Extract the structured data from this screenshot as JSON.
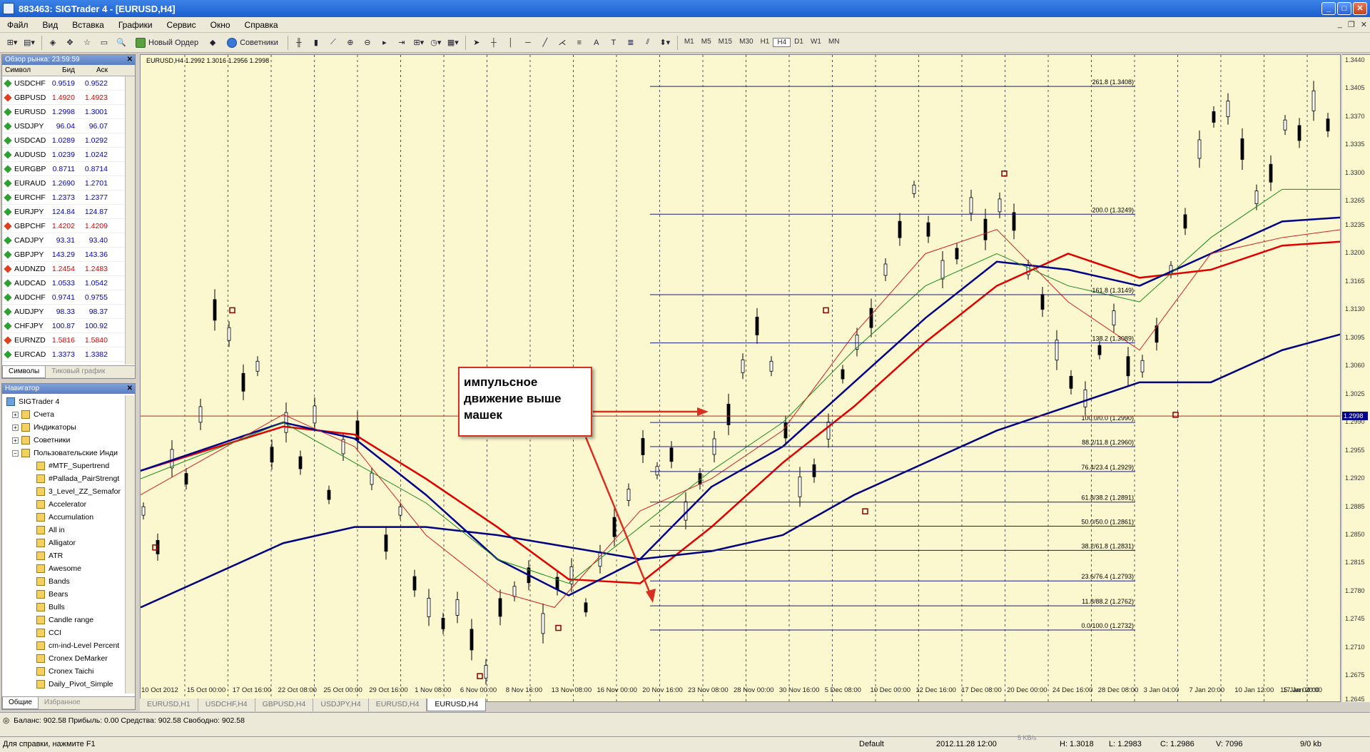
{
  "window": {
    "title": "883463: SIGTrader 4 - [EURUSD,H4]"
  },
  "menu": [
    "Файл",
    "Вид",
    "Вставка",
    "Графики",
    "Сервис",
    "Окно",
    "Справка"
  ],
  "toolbar": {
    "new_order": "Новый Ордер",
    "experts": "Советники",
    "timeframes": [
      "M1",
      "M5",
      "M15",
      "M30",
      "H1",
      "H4",
      "D1",
      "W1",
      "MN"
    ],
    "active_tf": "H4",
    "text_tool": "A",
    "label_tool": "T"
  },
  "market_watch": {
    "title": "Обзор рынка: 23:59:59",
    "headers": [
      "Символ",
      "Бид",
      "Аск"
    ],
    "rows": [
      {
        "s": "USDCHF",
        "b": "0.9519",
        "a": "0.9522",
        "d": "up"
      },
      {
        "s": "GBPUSD",
        "b": "1.4920",
        "a": "1.4923",
        "d": "dn"
      },
      {
        "s": "EURUSD",
        "b": "1.2998",
        "a": "1.3001",
        "d": "up"
      },
      {
        "s": "USDJPY",
        "b": "96.04",
        "a": "96.07",
        "d": "up"
      },
      {
        "s": "USDCAD",
        "b": "1.0289",
        "a": "1.0292",
        "d": "up"
      },
      {
        "s": "AUDUSD",
        "b": "1.0239",
        "a": "1.0242",
        "d": "up"
      },
      {
        "s": "EURGBP",
        "b": "0.8711",
        "a": "0.8714",
        "d": "up"
      },
      {
        "s": "EURAUD",
        "b": "1.2690",
        "a": "1.2701",
        "d": "up"
      },
      {
        "s": "EURCHF",
        "b": "1.2373",
        "a": "1.2377",
        "d": "up"
      },
      {
        "s": "EURJPY",
        "b": "124.84",
        "a": "124.87",
        "d": "up"
      },
      {
        "s": "GBPCHF",
        "b": "1.4202",
        "a": "1.4209",
        "d": "dn"
      },
      {
        "s": "CADJPY",
        "b": "93.31",
        "a": "93.40",
        "d": "up"
      },
      {
        "s": "GBPJPY",
        "b": "143.29",
        "a": "143.36",
        "d": "up"
      },
      {
        "s": "AUDNZD",
        "b": "1.2454",
        "a": "1.2483",
        "d": "dn"
      },
      {
        "s": "AUDCAD",
        "b": "1.0533",
        "a": "1.0542",
        "d": "up"
      },
      {
        "s": "AUDCHF",
        "b": "0.9741",
        "a": "0.9755",
        "d": "up"
      },
      {
        "s": "AUDJPY",
        "b": "98.33",
        "a": "98.37",
        "d": "up"
      },
      {
        "s": "CHFJPY",
        "b": "100.87",
        "a": "100.92",
        "d": "up"
      },
      {
        "s": "EURNZD",
        "b": "1.5816",
        "a": "1.5840",
        "d": "dn"
      },
      {
        "s": "EURCAD",
        "b": "1.3373",
        "a": "1.3382",
        "d": "up"
      }
    ],
    "tabs": [
      "Символы",
      "Тиковый график"
    ]
  },
  "navigator": {
    "title": "Навигатор",
    "root": "SIGTrader 4",
    "groups": [
      "Счета",
      "Индикаторы",
      "Советники",
      "Пользовательские Инди"
    ],
    "items": [
      "#MTF_Supertrend",
      "#Pallada_PairStrengt",
      "3_Level_ZZ_Semafor",
      "Accelerator",
      "Accumulation",
      "All in",
      "Alligator",
      "ATR",
      "Awesome",
      "Bands",
      "Bears",
      "Bulls",
      "Candle range",
      "CCI",
      "cm-ind-Level Percent",
      "Cronex DeMarker",
      "Cronex Taichi",
      "Daily_Pivot_Simple"
    ],
    "tabs": [
      "Общие",
      "Избранное"
    ]
  },
  "chart": {
    "symbol_line": "EURUSD,H4  1.2992 1.3016 1.2956 1.2998",
    "current_price": "1.2998",
    "yticks": [
      "1.3440",
      "1.3405",
      "1.3370",
      "1.3335",
      "1.3300",
      "1.3265",
      "1.3235",
      "1.3200",
      "1.3165",
      "1.3130",
      "1.3095",
      "1.3060",
      "1.3025",
      "1.2990",
      "1.2955",
      "1.2920",
      "1.2885",
      "1.2850",
      "1.2815",
      "1.2780",
      "1.2745",
      "1.2710",
      "1.2675",
      "1.2645"
    ],
    "xticks": [
      "10 Oct 2012",
      "15 Oct 00:00",
      "17 Oct 16:00",
      "22 Oct 08:00",
      "25 Oct 00:00",
      "29 Oct 16:00",
      "1 Nov 08:00",
      "6 Nov 00:00",
      "8 Nov 16:00",
      "13 Nov 08:00",
      "16 Nov 00:00",
      "20 Nov 16:00",
      "23 Nov 08:00",
      "28 Nov 00:00",
      "30 Nov 16:00",
      "5 Dec 08:00",
      "10 Dec 00:00",
      "12 Dec 16:00",
      "17 Dec 08:00",
      "20 Dec 00:00",
      "24 Dec 16:00",
      "28 Dec 08:00",
      "3 Jan 04:00",
      "7 Jan 20:00",
      "10 Jan 12:00",
      "15 Jan 04:00",
      "17 Jan 20:00"
    ],
    "fibo": [
      {
        "label": "261.8 (1.3408)",
        "price": 1.3408
      },
      {
        "label": "200.0 (1.3249)",
        "price": 1.3249
      },
      {
        "label": "161.8 (1.3149)",
        "price": 1.3149
      },
      {
        "label": "138.2 (1.3089)",
        "price": 1.3089
      },
      {
        "label": "100.0/0.0 (1.2990)",
        "price": 1.299
      },
      {
        "label": "88.2/11.8 (1.2960)",
        "price": 1.296
      },
      {
        "label": "76.4/23.4 (1.2929)",
        "price": 1.2929
      },
      {
        "label": "61.8/38.2 (1.2891)",
        "price": 1.2891
      },
      {
        "label": "50.0/50.0 (1.2861)",
        "price": 1.2861
      },
      {
        "label": "38.2/61.8 (1.2831)",
        "price": 1.2831
      },
      {
        "label": "23.6/76.4 (1.2793)",
        "price": 1.2793
      },
      {
        "label": "11.8/88.2 (1.2762)",
        "price": 1.2762
      },
      {
        "label": "0.0/100.0 (1.2732)",
        "price": 1.2732
      }
    ],
    "annotation": "импульсное движение выше машек",
    "tabs": [
      "EURUSD,H1",
      "USDCHF,H4",
      "GBPUSD,H4",
      "USDJPY,H4",
      "EURUSD,H4",
      "EURUSD,H4"
    ]
  },
  "terminal": {
    "balance_line": "Баланс: 902.58  Прибыль: 0.00  Средства: 902.58  Свободно: 902.58"
  },
  "status": {
    "help": "Для справки, нажмите F1",
    "profile": "Default",
    "time": "2012.11.28 12:00",
    "high": "H: 1.3018",
    "low": "L: 1.2983",
    "close": "C: 1.2986",
    "volume": "V: 7096",
    "traffic": "9/0 kb",
    "speed": "5 KB/s"
  }
}
